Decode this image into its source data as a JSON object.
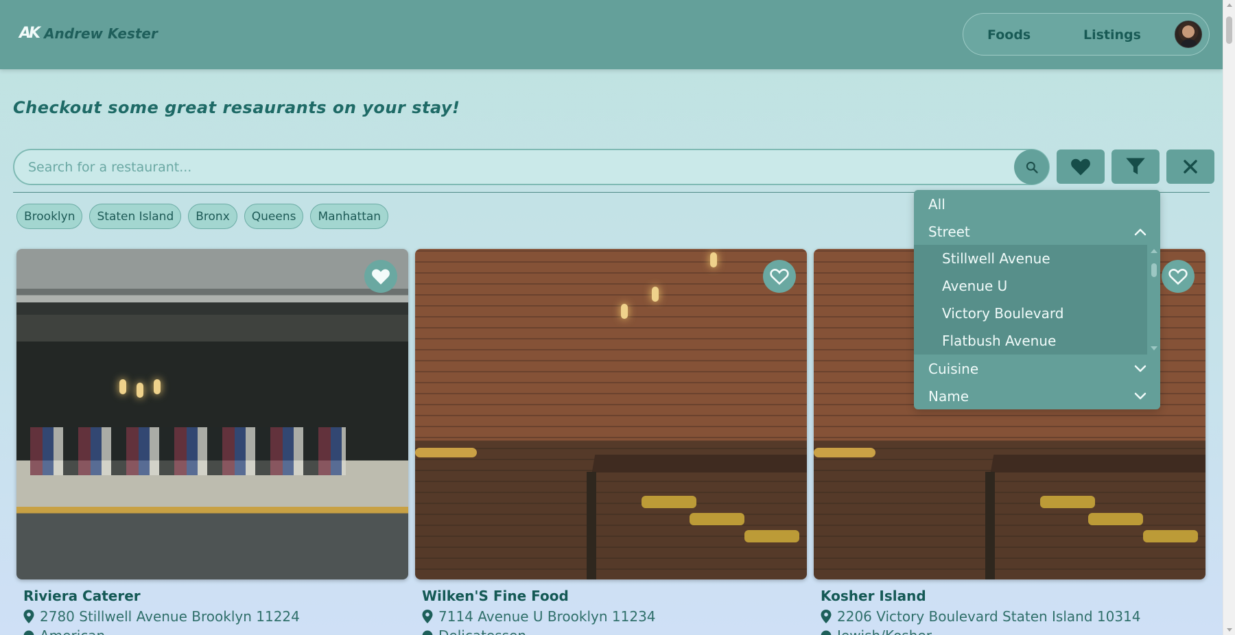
{
  "header": {
    "logo_text": "AK",
    "brand_name": "Andrew Kester",
    "nav": [
      {
        "label": "Foods"
      },
      {
        "label": "Listings"
      }
    ]
  },
  "page": {
    "heading": "Checkout some great resaurants on your stay!"
  },
  "search": {
    "placeholder": "Search for a restaurant...",
    "value": ""
  },
  "boroughs": [
    "Brooklyn",
    "Staten Island",
    "Bronx",
    "Queens",
    "Manhattan"
  ],
  "filter_menu": {
    "all_label": "All",
    "street_label": "Street",
    "street_options": [
      "Stillwell Avenue",
      "Avenue U",
      "Victory Boulevard",
      "Flatbush Avenue"
    ],
    "cuisine_label": "Cuisine",
    "name_label": "Name"
  },
  "restaurants": [
    {
      "name": "Riviera Caterer",
      "address": "2780 Stillwell Avenue Brooklyn 11224",
      "cuisine": "American",
      "favorited": true
    },
    {
      "name": "Wilken'S Fine Food",
      "address": "7114 Avenue U Brooklyn 11234",
      "cuisine": "Delicatessen",
      "favorited": false
    },
    {
      "name": "Kosher Island",
      "address": "2206 Victory Boulevard Staten Island 10314",
      "cuisine": "Jewish/Kosher",
      "favorited": false
    }
  ],
  "colors": {
    "header": "#64a09a",
    "accent": "#63a19b",
    "text_dark": "#145955"
  },
  "icons": {
    "search": "search-icon",
    "favorites": "heart-icon",
    "filter": "funnel-icon",
    "clear": "close-icon",
    "location": "map-pin-icon"
  }
}
